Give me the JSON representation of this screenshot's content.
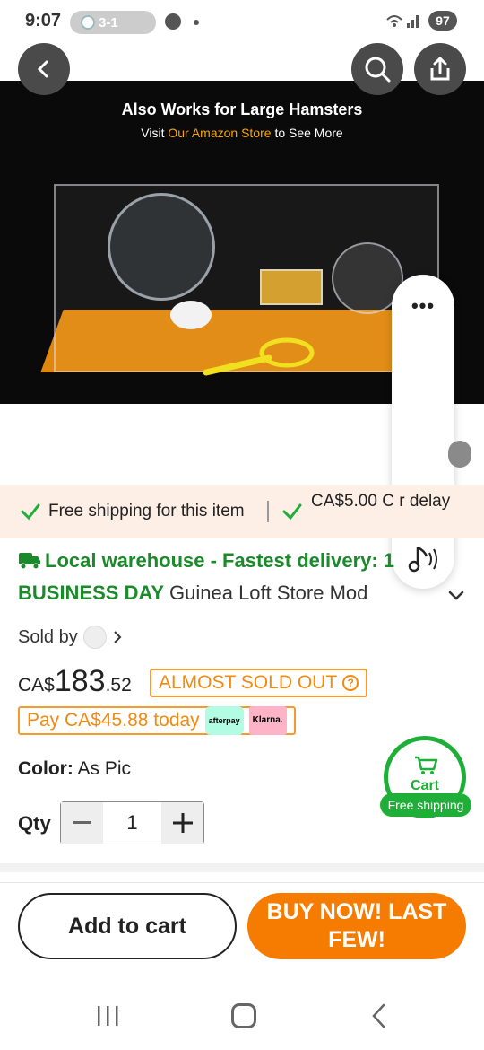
{
  "status_bar": {
    "time": "9:07",
    "score": "3-1",
    "battery": "97"
  },
  "hero": {
    "headline": "Also Works for Large Hamsters",
    "sub_prefix": "Visit",
    "sub_accent": "Our Amazon Store",
    "sub_suffix": "to See More",
    "accent_color": "#f6a500"
  },
  "shipping": {
    "item1": "Free shipping for this item",
    "item2": "CA$5.00 C          r delay"
  },
  "delivery": {
    "line": "Local warehouse - Fastest delivery: 1",
    "business_day": "BUSINESS DAY",
    "product_name": "Guinea Loft Store Mod"
  },
  "seller": {
    "label": "Sold by"
  },
  "pricing": {
    "currency": "CA$",
    "whole": "183",
    "decimal": ".52",
    "badge": "ALMOST SOLD OUT",
    "pay_today": "Pay CA$45.88 today",
    "afterpay": "afterpay",
    "klarna": "Klarna."
  },
  "color": {
    "label": "Color:",
    "value": "As Pic"
  },
  "cart_badge": {
    "label": "Cart",
    "free_shipping": "Free shipping"
  },
  "quantity": {
    "label": "Qty",
    "value": "1"
  },
  "actions": {
    "add_to_cart": "Add to cart",
    "buy_now": "BUY NOW! LAST FEW!"
  },
  "colors": {
    "green": "#1a8a2a",
    "orange": "#f57c00",
    "band": "#fdeee6"
  },
  "icons": [
    "back-icon",
    "search-icon",
    "share-icon",
    "more-icon",
    "audio-icon",
    "check-icon",
    "truck-icon",
    "chevron-down-icon",
    "cart-icon",
    "minus-icon",
    "plus-icon"
  ]
}
